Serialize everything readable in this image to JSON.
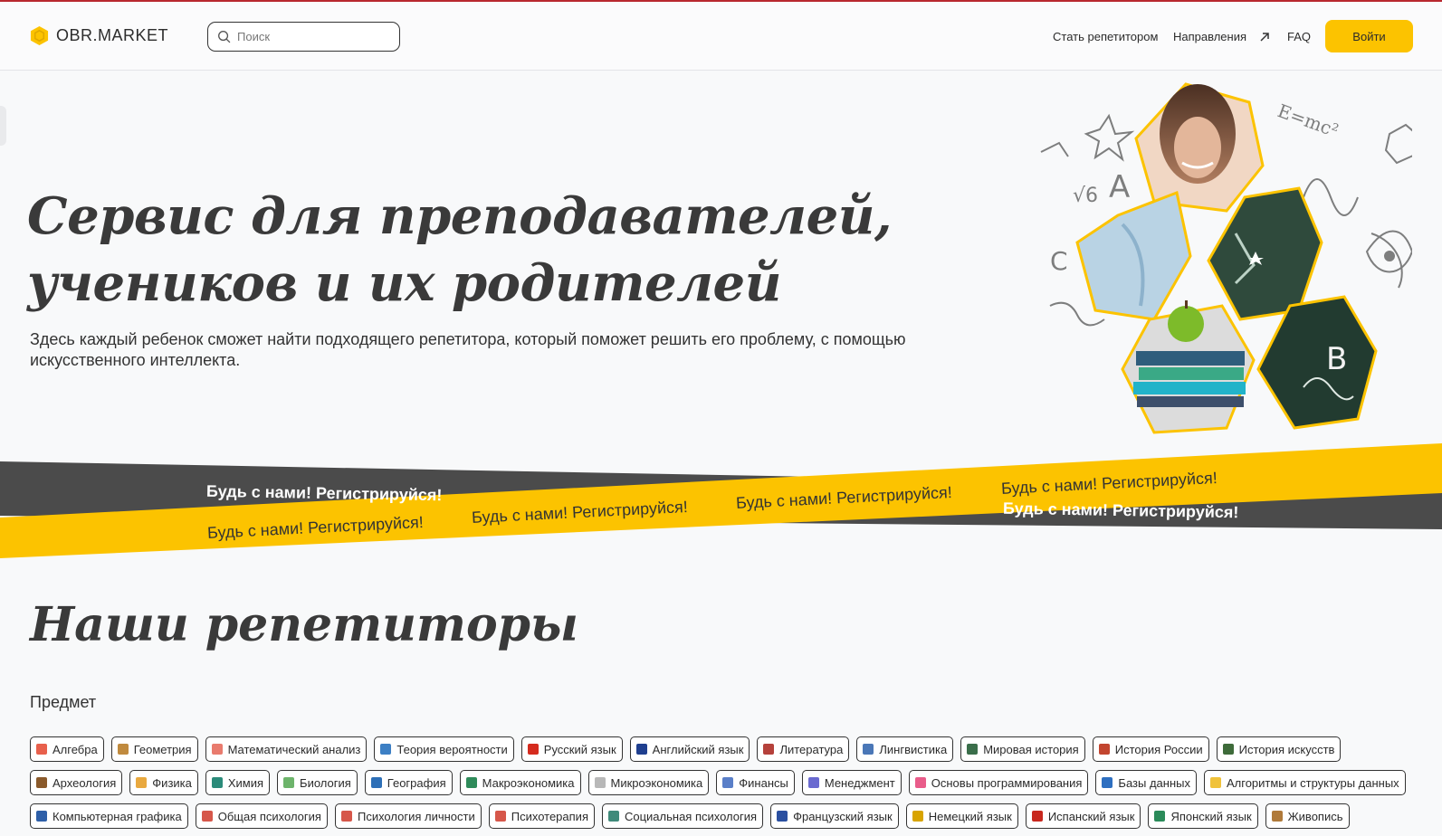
{
  "header": {
    "logo_text": "OBR.MARKET",
    "search_placeholder": "Поиск",
    "nav": {
      "become_tutor": "Стать репетитором",
      "directions": "Направления",
      "faq": "FAQ"
    },
    "login_label": "Войти"
  },
  "hero": {
    "title": "Сервис для преподавателей, учеников и их родителей",
    "subtitle": "Здесь каждый ребенок сможет найти подходящего репетитора, который поможет решить его проблему, с помощью искусственного интеллекта."
  },
  "ribbon": {
    "text": "Будь с нами! Регистрируйся!"
  },
  "tutors": {
    "title": "Наши репетиторы",
    "filter_label": "Предмет",
    "rows": [
      [
        {
          "label": "Алгебра",
          "icon": "algebra-icon",
          "color": "#e8604c"
        },
        {
          "label": "Геометрия",
          "icon": "geometry-icon",
          "color": "#c08a3e"
        },
        {
          "label": "Математический анализ",
          "icon": "calculus-icon",
          "color": "#e97b6e"
        },
        {
          "label": "Теория вероятности",
          "icon": "probability-icon",
          "color": "#3c7fc4"
        },
        {
          "label": "Русский язык",
          "icon": "russia-flag-icon",
          "color": "#d52b1e"
        },
        {
          "label": "Английский язык",
          "icon": "uk-flag-icon",
          "color": "#1f3f8f"
        },
        {
          "label": "Литература",
          "icon": "book-icon",
          "color": "#b5413b"
        },
        {
          "label": "Лингвистика",
          "icon": "linguistics-icon",
          "color": "#4a77b7"
        },
        {
          "label": "Мировая история",
          "icon": "world-history-icon",
          "color": "#3a6e4a"
        },
        {
          "label": "История России",
          "icon": "russia-history-icon",
          "color": "#c2452f"
        },
        {
          "label": "История искусств",
          "icon": "art-history-icon",
          "color": "#3e6b3a"
        }
      ],
      [
        {
          "label": "Археология",
          "icon": "archaeology-icon",
          "color": "#8a5a2b"
        },
        {
          "label": "Физика",
          "icon": "physics-icon",
          "color": "#e9a93f"
        },
        {
          "label": "Химия",
          "icon": "chemistry-icon",
          "color": "#2b8b7a"
        },
        {
          "label": "Биология",
          "icon": "biology-icon",
          "color": "#6db46b"
        },
        {
          "label": "География",
          "icon": "globe-icon",
          "color": "#2d6fb7"
        },
        {
          "label": "Макроэкономика",
          "icon": "macroeconomics-icon",
          "color": "#2f8b5a"
        },
        {
          "label": "Микроэкономика",
          "icon": "microeconomics-icon",
          "color": "#b8b8b8"
        },
        {
          "label": "Финансы",
          "icon": "finance-icon",
          "color": "#5a7fc8"
        },
        {
          "label": "Менеджмент",
          "icon": "management-icon",
          "color": "#6a6ad0"
        },
        {
          "label": "Основы программирования",
          "icon": "programming-icon",
          "color": "#e95c8a"
        },
        {
          "label": "Базы данных",
          "icon": "database-icon",
          "color": "#2e6fc0"
        },
        {
          "label": "Алгоритмы и структуры данных",
          "icon": "lightbulb-icon",
          "color": "#f0c23a"
        }
      ],
      [
        {
          "label": "Компьютерная графика",
          "icon": "computer-graphics-icon",
          "color": "#2e5fa8"
        },
        {
          "label": "Общая психология",
          "icon": "psychology-icon",
          "color": "#d6574a"
        },
        {
          "label": "Психология личности",
          "icon": "personality-icon",
          "color": "#d6574a"
        },
        {
          "label": "Психотерапия",
          "icon": "psychotherapy-icon",
          "color": "#d6574a"
        },
        {
          "label": "Социальная психология",
          "icon": "social-psychology-icon",
          "color": "#3f8a7a"
        },
        {
          "label": "Французский язык",
          "icon": "france-flag-icon",
          "color": "#2a4fa0"
        },
        {
          "label": "Немецкий язык",
          "icon": "germany-flag-icon",
          "color": "#d8a400"
        },
        {
          "label": "Испанский язык",
          "icon": "spain-flag-icon",
          "color": "#c8281e"
        },
        {
          "label": "Японский язык",
          "icon": "japanese-icon",
          "color": "#2b8b5a"
        },
        {
          "label": "Живопись",
          "icon": "painting-icon",
          "color": "#b07a3a"
        }
      ]
    ]
  },
  "colors": {
    "accent": "#fcc300",
    "dark_ribbon": "#4b4b4b",
    "text": "#2b2b2b"
  }
}
